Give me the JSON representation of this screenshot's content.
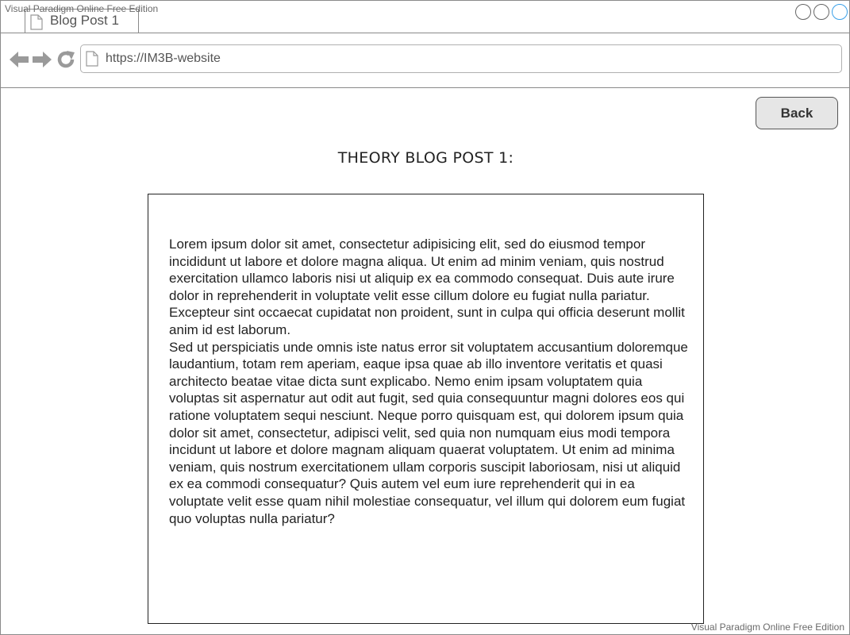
{
  "watermark": {
    "top": "Visual Paradigm Online Free Edition",
    "bottom": "Visual Paradigm Online Free Edition"
  },
  "browser": {
    "tab_title": "Blog Post 1",
    "url": "https://IM3B-website",
    "icons": {
      "back": "arrow-left-icon",
      "forward": "arrow-right-icon",
      "reload": "reload-icon",
      "page": "document-icon"
    },
    "accent_color": "#3aa0e8"
  },
  "page": {
    "back_label": "Back",
    "heading": "THEORY BLOG POST 1:",
    "paragraphs": [
      "Lorem ipsum dolor sit amet, consectetur adipisicing elit, sed do eiusmod tempor incididunt ut labore et dolore magna aliqua. Ut enim ad minim veniam, quis nostrud exercitation ullamco laboris nisi ut aliquip ex ea commodo consequat. Duis aute irure dolor in reprehenderit in voluptate velit esse cillum dolore eu fugiat nulla pariatur. Excepteur sint occaecat cupidatat non proident, sunt in culpa qui officia deserunt mollit anim id est laborum.",
      "Sed ut perspiciatis unde omnis iste natus error sit voluptatem accusantium doloremque laudantium, totam rem aperiam, eaque ipsa quae ab illo inventore veritatis et quasi architecto beatae vitae dicta sunt explicabo. Nemo enim ipsam voluptatem quia voluptas sit aspernatur aut odit aut fugit, sed quia consequuntur magni dolores eos qui ratione voluptatem sequi nesciunt. Neque porro quisquam est, qui dolorem ipsum quia dolor sit amet, consectetur, adipisci velit, sed quia non numquam eius modi tempora incidunt ut labore et dolore magnam aliquam quaerat voluptatem. Ut enim ad minima veniam, quis nostrum exercitationem ullam corporis suscipit laboriosam, nisi ut aliquid ex ea commodi consequatur? Quis autem vel eum iure reprehenderit qui in ea voluptate velit esse quam nihil molestiae consequatur, vel illum qui dolorem eum fugiat quo voluptas nulla pariatur?"
    ]
  }
}
